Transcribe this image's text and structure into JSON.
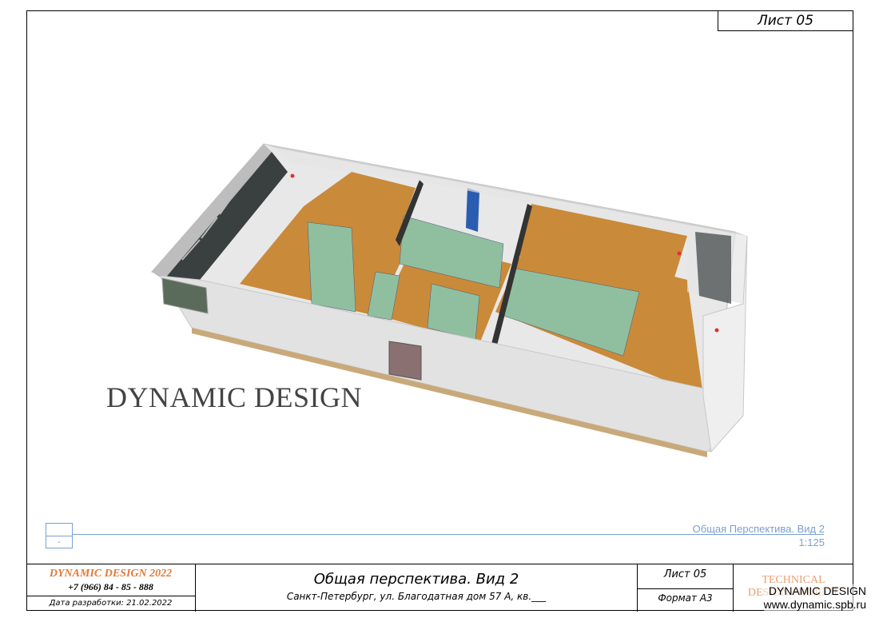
{
  "sheet": {
    "number": "Лист 05"
  },
  "watermark": "DYNAMIC DESIGN",
  "view": {
    "caption": "Общая Перспектива. Вид 2",
    "scale": "1:125",
    "marker": "-"
  },
  "titleblock": {
    "company": "DYNAMIC  DESIGN  2022",
    "phone": "+7  (966)  84 - 85 - 888",
    "date": "Дата разработки: 21.02.2022",
    "title": "Общая перспектива. Вид 2",
    "address": "Санкт-Петербург, ул. Благодатная дом 57 А, кв.___",
    "sheet": "Лист 05",
    "format": "Формат А3",
    "tech_line1": "TECHNICAL",
    "tech_line2": "DESIGN PROJECT"
  },
  "brand": {
    "name": "DYNAMIC DESIGN",
    "url": "www.dynamic.spb.ru"
  },
  "colors": {
    "accent": "#e07b39",
    "caption": "#7aa0d0",
    "floor": "#c98a3a",
    "partition": "#8fbf9f",
    "wall": "#dcdcdc"
  }
}
